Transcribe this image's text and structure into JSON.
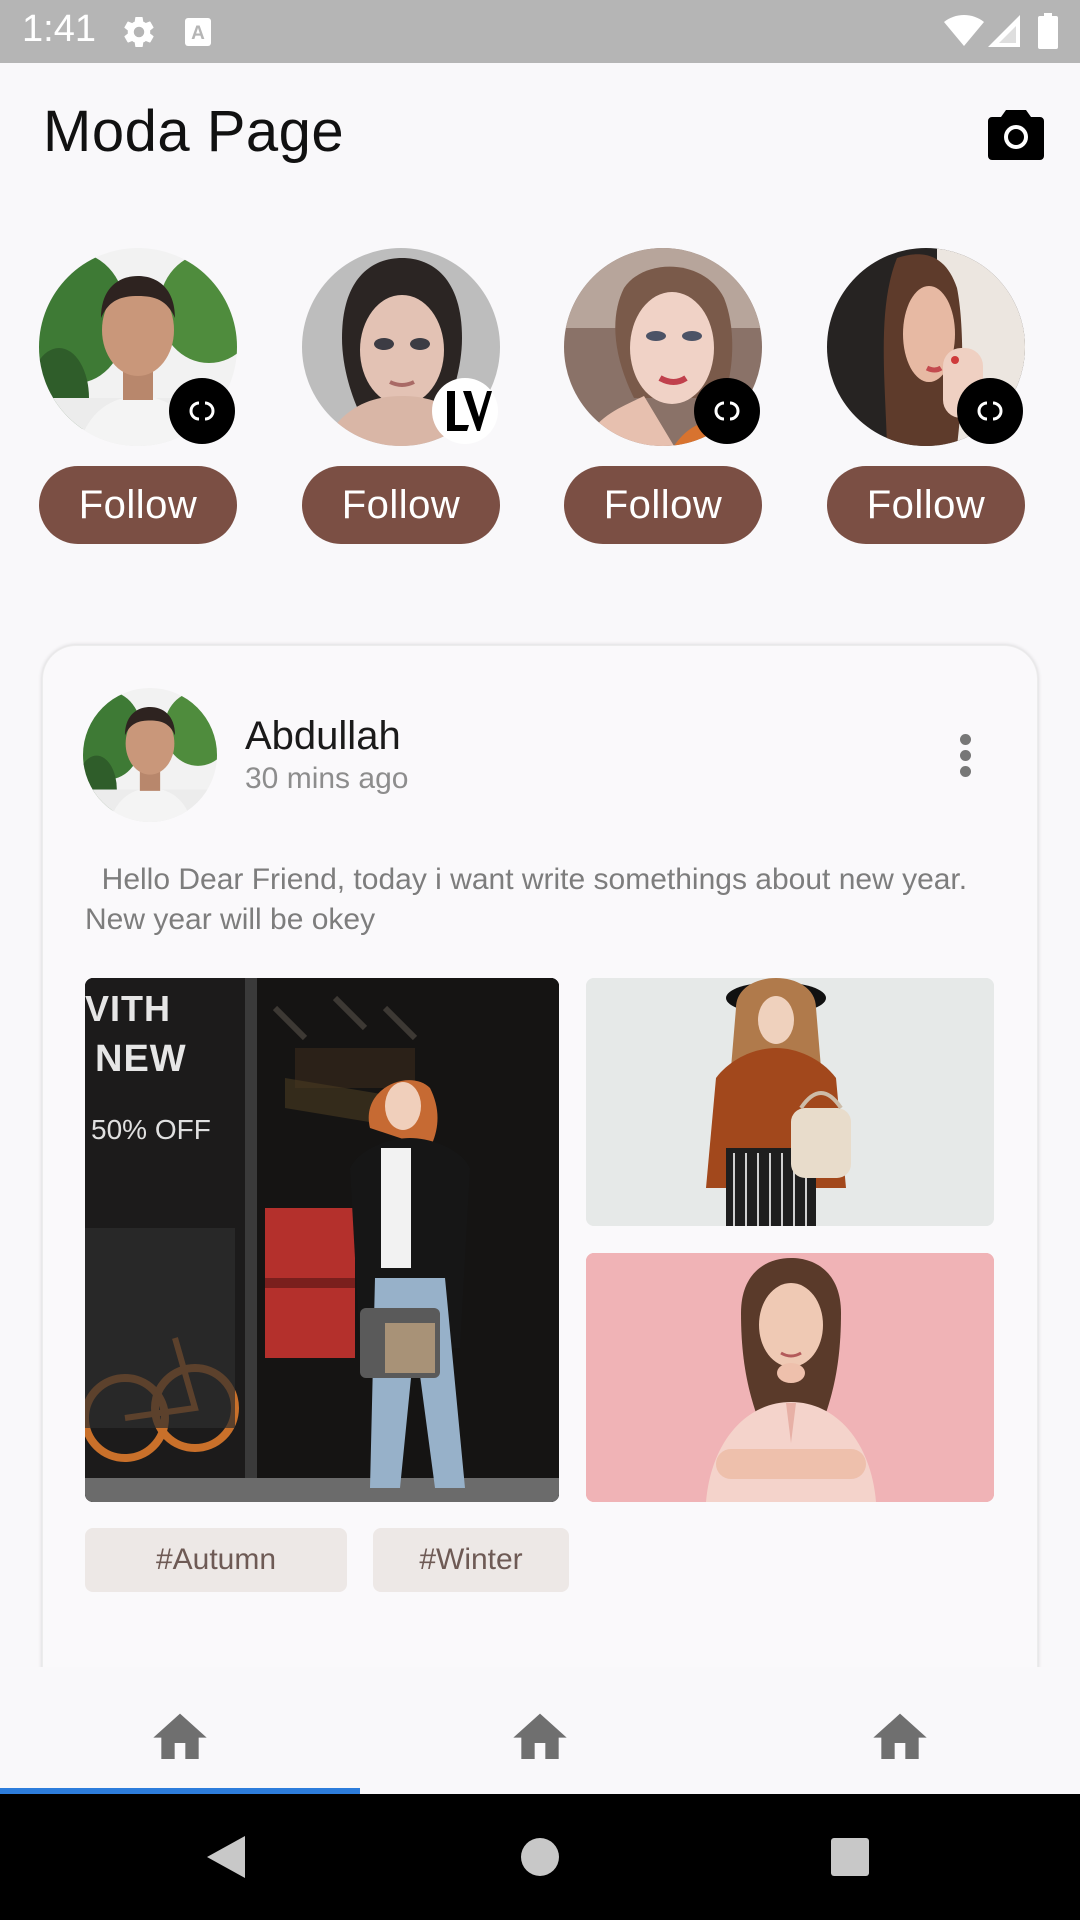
{
  "status_bar": {
    "time": "1:41",
    "icons": [
      "settings-icon",
      "text-icon",
      "wifi-icon",
      "signal-icon",
      "battery-icon"
    ]
  },
  "header": {
    "title": "Moda Page",
    "camera_icon": "camera-icon"
  },
  "stories": [
    {
      "name": "man",
      "badge": "chanel-logo",
      "follow_label": "Follow"
    },
    {
      "name": "woman-dark-hair",
      "badge": "lv-logo",
      "follow_label": "Follow"
    },
    {
      "name": "woman-blonde",
      "badge": "chanel-logo",
      "follow_label": "Follow"
    },
    {
      "name": "woman-long-hair",
      "badge": "chanel-logo",
      "follow_label": "Follow"
    }
  ],
  "post": {
    "author": "Abdullah",
    "time": "30 mins ago",
    "text": "  Hello Dear Friend, today i want write somethings about new year. New year will be okey",
    "photo_1_overlay": [
      "VITH",
      "NEW",
      "50% OFF"
    ],
    "tags": [
      "#Autumn",
      "#Winter"
    ]
  },
  "bottom_nav": {
    "items": [
      "home-icon",
      "home-icon",
      "home-icon"
    ],
    "active_index": 0
  },
  "colors": {
    "accent": "#7b4f44",
    "indicator": "#2d7ddb",
    "tag_bg": "#ede8e6",
    "status_bar": "#b5b5b5"
  }
}
